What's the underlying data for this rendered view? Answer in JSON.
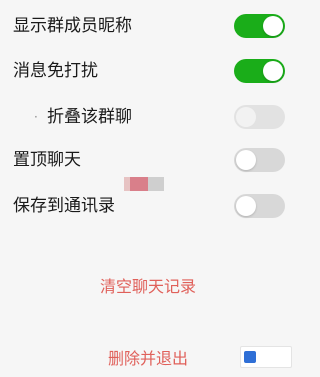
{
  "settings": [
    {
      "label": "显示群成员昵称",
      "toggle_state": "on"
    },
    {
      "label": "消息免打扰",
      "toggle_state": "on"
    },
    {
      "label": "折叠该群聊",
      "toggle_state": "disabled",
      "prefix": "·"
    },
    {
      "label": "置顶聊天",
      "toggle_state": "off"
    },
    {
      "label": "保存到通讯录",
      "toggle_state": "off"
    }
  ],
  "actions": {
    "clear_history": "清空聊天记录",
    "delete_and_exit": "删除并退出"
  },
  "colors": {
    "toggle_on": "#1aad19",
    "toggle_off": "#d8d8d8",
    "action_text": "#e0605a",
    "background": "#f6f6f6"
  },
  "icons": {
    "toggle": "switch-icon"
  }
}
